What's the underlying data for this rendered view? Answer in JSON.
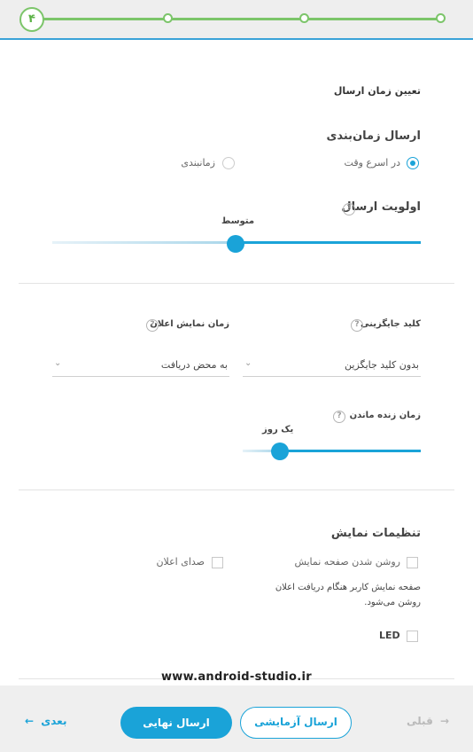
{
  "stepper": {
    "current_step": "۴",
    "total_steps": 4,
    "accent": "#7cc56a",
    "trail": "#3aa3d8"
  },
  "schedule": {
    "section_title": "تعیین زمان ارسال",
    "send_schedule_label": "ارسال زمان‌بندی",
    "option_asap": "در اسرع وقت",
    "option_scheduled": "زمانبندی",
    "selected": "در اسرع وقت"
  },
  "priority": {
    "label": "اولویت ارسال",
    "help": "?",
    "value_label": "متوسط",
    "level": 0.5
  },
  "delivery": {
    "collapse_key_label": "کلید جایگزینی",
    "collapse_key_help": "?",
    "collapse_key_value": "بدون کلید جایگزین",
    "display_time_label": "زمان نمایش اعلان",
    "display_time_help": "?",
    "display_time_value": "به محض دریافت",
    "ttl_label": "زمان زنده ماندن",
    "ttl_help": "?",
    "ttl_value_label": "یک روز",
    "ttl_level": 0.2
  },
  "display_settings": {
    "title": "تنظیمات نمایش",
    "screen_on_label": "روشن شدن صفحه نمایش",
    "screen_on_description": "صفحه نمایش کاربر هنگام دریافت اعلان روشن می‌شود.",
    "sound_label": "صدای اعلان",
    "led_label": "LED"
  },
  "watermark": "www.android-studio.ir",
  "footer": {
    "next_label": "بعدی",
    "prev_label": "قبلی",
    "final_send_label": "ارسال نهایی",
    "test_send_label": "ارسال آزمایشی"
  },
  "colors": {
    "primary": "#1aa3d8",
    "success": "#7cc56a"
  }
}
